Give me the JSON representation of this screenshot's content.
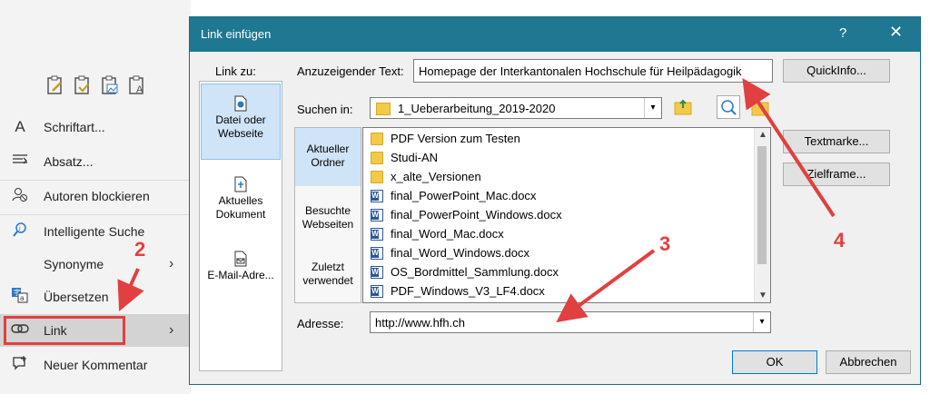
{
  "context_menu": {
    "items": [
      {
        "icon": "font-icon",
        "label": "Schriftart..."
      },
      {
        "icon": "paragraph-icon",
        "label": "Absatz..."
      },
      {
        "icon": "block-authors-icon",
        "label": "Autoren blockieren"
      },
      {
        "icon": "smart-lookup-icon",
        "label": "Intelligente Suche"
      },
      {
        "icon": "",
        "label": "Synonyme"
      },
      {
        "icon": "translate-icon",
        "label": "Übersetzen"
      },
      {
        "icon": "link-icon",
        "label": "Link"
      },
      {
        "icon": "new-comment-icon",
        "label": "Neuer Kommentar"
      }
    ],
    "submenu_arrow": "›"
  },
  "dialog": {
    "title": "Link einfügen",
    "help": "?",
    "close": "✕",
    "link_to_label": "Link zu:",
    "link_to": [
      {
        "label": "Datei oder Webseite"
      },
      {
        "label": "Aktuelles Dokument"
      },
      {
        "label": "E-Mail-Adre..."
      }
    ],
    "display_text_label": "Anzuzeigender Text:",
    "display_text_value": "Homepage der Interkantonalen Hochschule für Heilpädagogik",
    "search_in_label": "Suchen in:",
    "search_in_value": "1_Ueberarbeitung_2019-2020",
    "browse_nav": [
      {
        "label": "Aktueller Ordner"
      },
      {
        "label": "Besuchte Webseiten"
      },
      {
        "label": "Zuletzt verwendet"
      }
    ],
    "files": [
      {
        "type": "folder",
        "name": "PDF Version zum Testen"
      },
      {
        "type": "folder",
        "name": "Studi-AN"
      },
      {
        "type": "folder",
        "name": "x_alte_Versionen"
      },
      {
        "type": "doc",
        "name": "final_PowerPoint_Mac.docx"
      },
      {
        "type": "doc",
        "name": "final_PowerPoint_Windows.docx"
      },
      {
        "type": "doc",
        "name": "final_Word_Mac.docx"
      },
      {
        "type": "doc",
        "name": "final_Word_Windows.docx"
      },
      {
        "type": "doc",
        "name": "OS_Bordmittel_Sammlung.docx"
      },
      {
        "type": "doc",
        "name": "PDF_Windows_V3_LF4.docx"
      }
    ],
    "address_label": "Adresse:",
    "address_value": "http://www.hfh.ch",
    "buttons": {
      "quickinfo": "QuickInfo...",
      "textmarke": "Textmarke...",
      "zielframe": "Zielframe...",
      "ok": "OK",
      "cancel": "Abbrechen"
    }
  },
  "annotations": [
    "2",
    "3",
    "4"
  ],
  "colors": {
    "titlebar": "#207792",
    "highlight": "#cfe4f7",
    "annotation": "#e0403f"
  }
}
